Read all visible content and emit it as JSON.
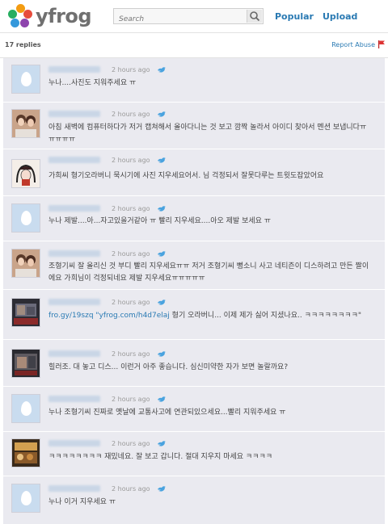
{
  "header": {
    "logo_text": "yfrog",
    "search_placeholder": "Search",
    "nav": [
      "Popular",
      "Upload"
    ]
  },
  "bar": {
    "replies": "17 replies",
    "report": "Report Abuse"
  },
  "replies": [
    {
      "avatar": "egg",
      "time": "2 hours ago",
      "text": "누나....사진도 지워주세요 ㅠ"
    },
    {
      "avatar": "photo-two-women",
      "time": "2 hours ago",
      "text": "아침 새벽에 컴퓨터하다가 저거 캡쳐해서 올아다니는 것 보고 깜짝 놀라서 아이디 찾아서 멘션 보냅니다ㅠㅠㅠㅠㅠ"
    },
    {
      "avatar": "drawing",
      "time": "2 hours ago",
      "text": "가희씨 형기오라버니 묵시기에 사진 지우세요어서. 님 걱정되서 잘못다루는 트윗도잡았어요"
    },
    {
      "avatar": "egg",
      "time": "2 hours ago",
      "text": "누나 제발....아...자고있을거같아 ㅠ 빨리 지우세요....아오 제발 보세요 ㅠ"
    },
    {
      "avatar": "photo-two-women",
      "time": "2 hours ago",
      "text": "조형기씨 잘 올리신 것 부디 빨리 지우세요ㅠㅠ 저거 조형기씨 뻥소니 사고 네티즌이 디스하려고 만든 짤이에요 가희님이 걱정되네요 제발 지우세요ㅠㅠㅠㅠㅠ"
    },
    {
      "avatar": "photo-dark",
      "time": "2 hours ago",
      "text_link": "fro.gy/19szq \"yfrog.com/h4d7elaj",
      "text": " 형기 오라버니... 이제 제가 싫어 지셨나요.. ㅋㅋㅋㅋㅋㅋㅋㅋ\""
    },
    {
      "avatar": "photo-dark",
      "time": "2 hours ago",
      "text": "힐러조. 대 놓고 디스... 이런거 아주 좋습니다. 심신미약한 자가 보면 놀랄까요?"
    },
    {
      "avatar": "egg",
      "time": "2 hours ago",
      "text": "누나 조형기씨 진짜로 옛날에 교통사고에 연관되있으세요...빨리 지워주세요 ㅠ"
    },
    {
      "avatar": "photo-warm",
      "time": "2 hours ago",
      "text": "ㅋㅋㅋㅋㅋㅋㅋㅋ 재밌네요. 잘 보고 갑니다. 절대 지우지 마세요 ㅋㅋㅋㅋ"
    },
    {
      "avatar": "egg",
      "time": "2 hours ago",
      "text": "누나 이거 지우세요 ㅠ"
    }
  ]
}
